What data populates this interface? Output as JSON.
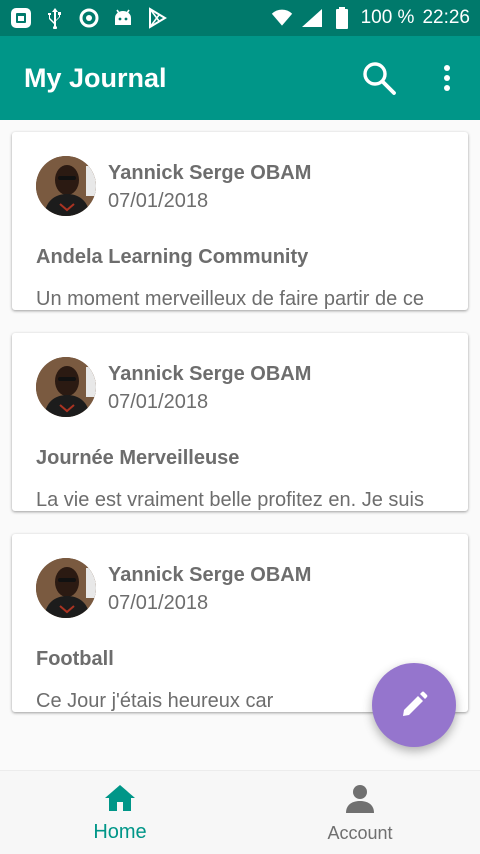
{
  "status_bar": {
    "battery": "100 %",
    "time": "22:26",
    "left_icons": [
      "calendar-app-icon",
      "usb-icon",
      "sync-icon",
      "android-icon",
      "play-store-icon"
    ],
    "right_icons": [
      "wifi-icon",
      "signal-icon",
      "battery-icon"
    ]
  },
  "app_bar": {
    "title": "My Journal",
    "actions": [
      "search-icon",
      "more-vert-icon"
    ]
  },
  "entries": [
    {
      "author": "Yannick Serge OBAM",
      "date": "07/01/2018",
      "title": "Andela Learning Community",
      "excerpt": "Un moment merveilleux de faire partir de ce"
    },
    {
      "author": "Yannick Serge OBAM",
      "date": "07/01/2018",
      "title": "Journée Merveilleuse",
      "excerpt": "La vie est vraiment belle profitez en. Je suis"
    },
    {
      "author": "Yannick Serge OBAM",
      "date": "07/01/2018",
      "title": "Football",
      "excerpt": "Ce Jour j'étais heureux car"
    }
  ],
  "fab": {
    "icon": "pencil-icon"
  },
  "bottom_nav": {
    "items": [
      {
        "label": "Home",
        "icon": "home-icon",
        "active": true
      },
      {
        "label": "Account",
        "icon": "account-icon",
        "active": false
      }
    ]
  },
  "colors": {
    "primary": "#009688",
    "primary_dark": "#00796b",
    "accent": "#9575cd",
    "text_secondary": "#6d6d6d"
  }
}
